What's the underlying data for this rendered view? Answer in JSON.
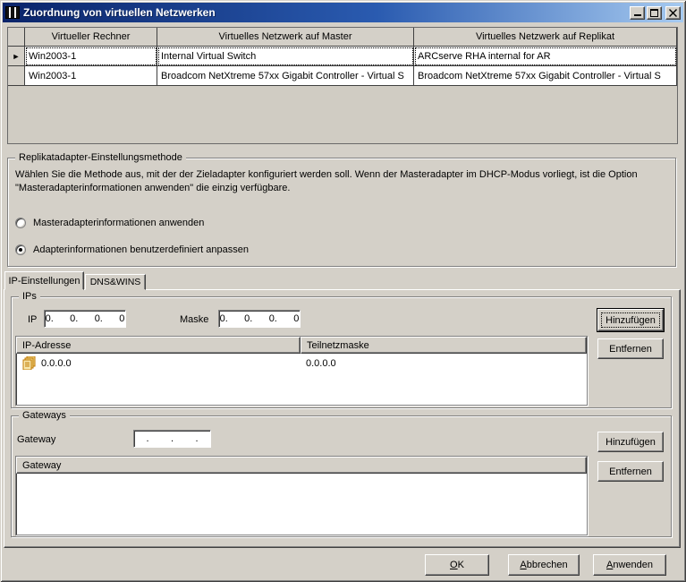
{
  "window": {
    "title": "Zuordnung von virtuellen Netzwerken"
  },
  "icons": {
    "row_selector": "►"
  },
  "grid": {
    "columns": [
      "Virtueller Rechner",
      "Virtuelles Netzwerk auf Master",
      "Virtuelles Netzwerk auf Replikat"
    ],
    "rows": [
      {
        "selected": true,
        "cells": [
          "Win2003-1",
          "Internal Virtual Switch",
          "ARCserve RHA internal for AR"
        ]
      },
      {
        "selected": false,
        "cells": [
          "Win2003-1",
          "Broadcom NetXtreme 57xx Gigabit Controller - Virtual S",
          "Broadcom NetXtreme 57xx Gigabit Controller - Virtual S"
        ]
      }
    ]
  },
  "method_group": {
    "title": "Replikatadapter-Einstellungsmethode",
    "description_line1": "Wählen Sie die Methode aus, mit der der Zieladapter konfiguriert werden soll. Wenn der Masteradapter im DHCP-Modus vorliegt, ist die Option",
    "description_line2": "\"Masteradapterinformationen anwenden\" die einzig verfügbare.",
    "radios": [
      {
        "label": "Masteradapterinformationen anwenden",
        "selected": false
      },
      {
        "label": "Adapterinformationen benutzerdefiniert anpassen",
        "selected": true
      }
    ]
  },
  "tabs": [
    {
      "label": "IP-Einstellungen",
      "active": true
    },
    {
      "label": "DNS&WINS",
      "active": false
    }
  ],
  "ip_section": {
    "group_title": "IPs",
    "ip_label": "IP",
    "ip_value": "0.      0.      0.      0",
    "mask_label": "Maske",
    "mask_value": "0.      0.      0.      0",
    "add_label": "Hinzufügen",
    "remove_label": "Entfernen",
    "list": {
      "columns": [
        "IP-Adresse",
        "Teilnetzmaske"
      ],
      "rows": [
        {
          "ip": "0.0.0.0",
          "mask": "0.0.0.0"
        }
      ]
    }
  },
  "gateway_section": {
    "group_title": "Gateways",
    "gateway_label": "Gateway",
    "gateway_value": " .        .        . ",
    "add_label": "Hinzufügen",
    "remove_label": "Entfernen",
    "list": {
      "columns": [
        "Gateway"
      ],
      "rows": []
    }
  },
  "footer": {
    "ok": {
      "accel": "O",
      "rest": "K"
    },
    "cancel": {
      "accel": "A",
      "rest": "bbrechen"
    },
    "apply": {
      "accel": "A",
      "rest": "nwenden"
    }
  },
  "colors": {
    "titlebar_start": "#0a246a",
    "titlebar_end": "#a6caf0",
    "dialog_bg": "#d4d0c8",
    "text": "#000000"
  }
}
